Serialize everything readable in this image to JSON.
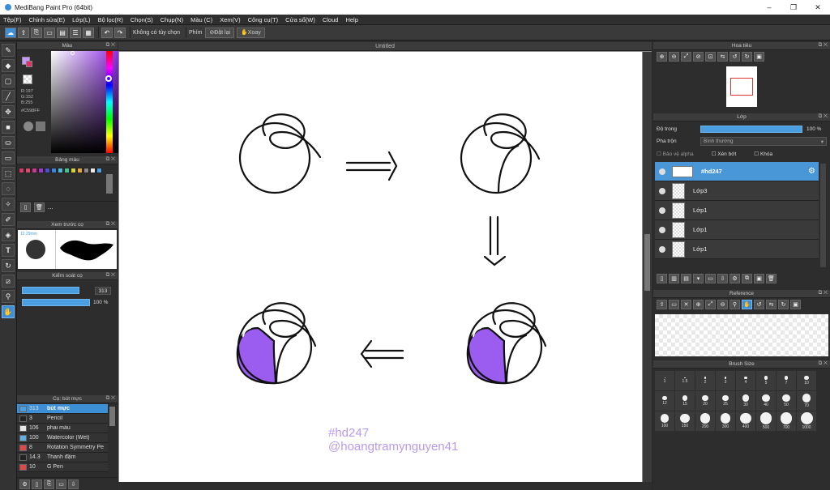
{
  "window": {
    "title": "MediBang Paint Pro (64bit)",
    "controls": [
      "–",
      "❐",
      "✕"
    ]
  },
  "menu": [
    "Tệp(F)",
    "Chỉnh sửa(E)",
    "Lớp(L)",
    "Bộ lọc(R)",
    "Chọn(S)",
    "Chụp(N)",
    "Màu (C)",
    "Xem(V)",
    "Công cụ(T)",
    "Cửa sổ(W)",
    "Cloud",
    "Help"
  ],
  "toolbar": {
    "no_selection": "Không có tùy chọn",
    "keys_label": "Phím",
    "reset_label": "Đặt lại",
    "rotate_label": "Xoay"
  },
  "color_panel": {
    "title": "Màu",
    "r": "R:197",
    "g": "G:152",
    "b": "B:255",
    "hex": "#C598FF",
    "primary_color": "#c598ff",
    "secondary_color": "#e0306a"
  },
  "palette_panel": {
    "title": "Bảng màu",
    "swatches": [
      "#d63a6a",
      "#e0466e",
      "#c53d8a",
      "#9b3cc9",
      "#4b4fd6",
      "#3a86d9",
      "#4fb9e0",
      "#46c48b",
      "#d6d23f",
      "#e8a53a",
      "#8a8a8a",
      "#e8e8e8",
      "#4f9ee6"
    ],
    "more": "..."
  },
  "brush_preview_panel": {
    "title": "Xem trước cọ",
    "size_label": "12.29mm"
  },
  "brush_control_panel": {
    "title": "Kiểm soát cọ",
    "size_value": "313",
    "opacity_value": "100 %",
    "size_fraction": 0.85,
    "opacity_fraction": 1.0
  },
  "brush_list_panel": {
    "title": "Cọ: bút mực",
    "rows": [
      {
        "size": "313",
        "name": "bút mực",
        "color": "#4b9edf",
        "selected": true
      },
      {
        "size": "3",
        "name": "Pencil",
        "color": "#222222",
        "selected": false
      },
      {
        "size": "106",
        "name": "phai màu",
        "color": "#e7e7e7",
        "selected": false
      },
      {
        "size": "100",
        "name": "Watercolor (Wet)",
        "color": "#60b0e8",
        "selected": false
      },
      {
        "size": "8",
        "name": "Rotation Symmetry Pe",
        "color": "#e04848",
        "selected": false
      },
      {
        "size": "14.3",
        "name": "Thanh đậm",
        "color": "#222222",
        "selected": false
      },
      {
        "size": "10",
        "name": "G Pen",
        "color": "#e04848",
        "selected": false
      }
    ]
  },
  "document": {
    "tab_title": "Untitled",
    "watermark_line1": "#hd247",
    "watermark_line2": "@hoangtramynguyen41",
    "fill_color": "#9b5cf0"
  },
  "navigator_panel": {
    "title": "Hoa tiêu"
  },
  "layer_panel": {
    "title": "Lớp",
    "opacity_label": "Độ trong",
    "opacity_value": "100 %",
    "opacity_fraction": 1.0,
    "blend_label": "Pha trộn",
    "blend_value": "Bình thường",
    "protect_alpha": "Bảo vệ alpha",
    "clipping": "Xén bớt",
    "lock": "Khóa",
    "layers": [
      {
        "name": "#hd247",
        "selected": true
      },
      {
        "name": "Lớp3",
        "selected": false
      },
      {
        "name": "Lớp1",
        "selected": false
      },
      {
        "name": "Lớp1",
        "selected": false
      },
      {
        "name": "Lớp1",
        "selected": false
      }
    ]
  },
  "reference_panel": {
    "title": "Reference"
  },
  "brush_size_panel": {
    "title": "Brush Size",
    "sizes": [
      "1",
      "1.5",
      "2",
      "3",
      "4",
      "5",
      "7",
      "10",
      "12",
      "15",
      "20",
      "25",
      "30",
      "40",
      "50",
      "70",
      "100",
      "150",
      "200",
      "300",
      "400",
      "500",
      "700",
      "1000"
    ]
  }
}
